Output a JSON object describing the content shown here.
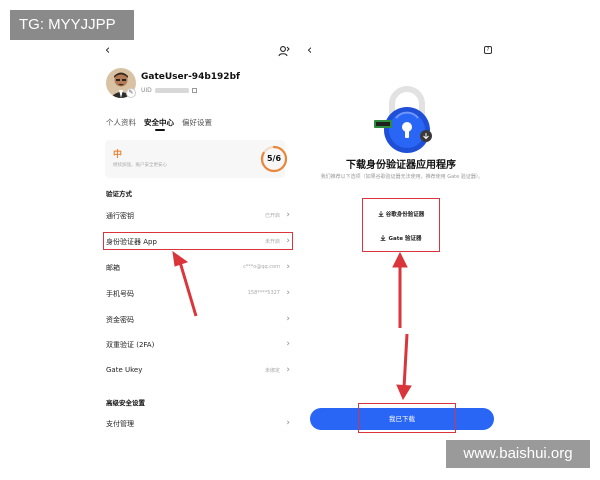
{
  "watermarks": {
    "tg": "TG: MYYJJPP",
    "site": "www.baishui.org"
  },
  "left_screen": {
    "profile": {
      "username": "GateUser-94b192bf",
      "uid_label": "UID"
    },
    "tabs": [
      {
        "label": "个人资料",
        "active": false
      },
      {
        "label": "安全中心",
        "active": true
      },
      {
        "label": "偏好设置",
        "active": false
      }
    ],
    "security_level": {
      "label": "中",
      "description": "继续加强，账户安全更安心",
      "score": "5/6",
      "progress": 0.83,
      "color": "#e8873a"
    },
    "verification_title": "验证方式",
    "verification_rows": [
      {
        "label": "通行密钥",
        "value": "已开启"
      },
      {
        "label": "身份验证器 App",
        "value": "未开启"
      },
      {
        "label": "邮箱",
        "value": "c***o@qq.com"
      },
      {
        "label": "手机号码",
        "value": "158****5327"
      },
      {
        "label": "资金密码",
        "value": ""
      },
      {
        "label": "双重验证 (2FA)",
        "value": ""
      },
      {
        "label": "Gate Ukey",
        "value": "未绑定"
      }
    ],
    "advanced_title": "高级安全设置",
    "advanced_rows": [
      {
        "label": "支付管理",
        "value": ""
      }
    ]
  },
  "right_screen": {
    "title": "下载身份验证器应用程序",
    "description": "我们推荐以下选项（如果谷歌验证器无法使用，推荐使用 Gate 验证器）。",
    "download_buttons": [
      {
        "label": "谷歌身份验证器"
      },
      {
        "label": "Gate 验证器"
      }
    ],
    "done_label": "我已下载"
  },
  "colors": {
    "accent": "#2a66f5",
    "highlight": "#d9353a",
    "level": "#e8873a"
  }
}
